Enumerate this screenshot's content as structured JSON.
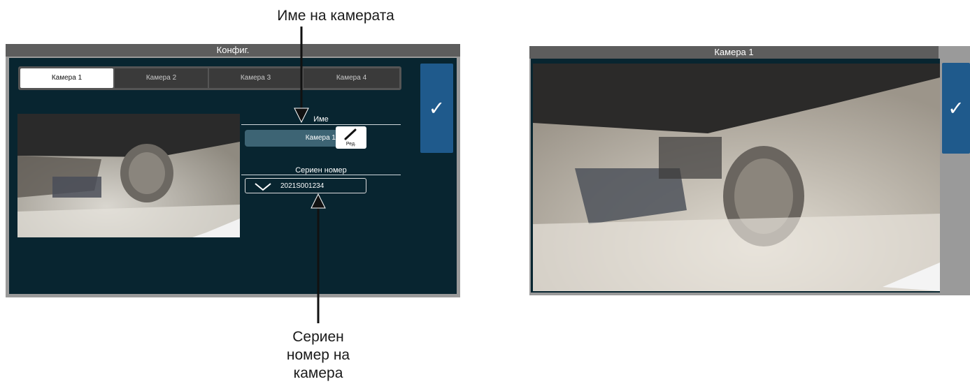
{
  "callouts": {
    "camera_name": "Име на камерата",
    "serial_lines": [
      "Сериен",
      "номер на",
      "камера"
    ]
  },
  "config_screen": {
    "title": "Конфиг.",
    "tabs": [
      "Камера 1",
      "Камера 2",
      "Камера 3",
      "Камера 4"
    ],
    "active_tab_index": 0,
    "name_label": "Име",
    "name_value": "Камера 1",
    "edit_label": "Ред.",
    "serial_label": "Сериен номер",
    "serial_value": "2021S001234",
    "confirm_icon": "check-icon",
    "preview_icon": "camera-preview-image"
  },
  "camera_screen": {
    "title": "Камера 1",
    "confirm_icon": "check-icon",
    "feed_icon": "camera-feed-image"
  },
  "colors": {
    "screen_bg": "#082530",
    "title_bar": "#5d5d5d",
    "confirm_button": "#1f5a8c",
    "name_field": "#3d6474"
  }
}
